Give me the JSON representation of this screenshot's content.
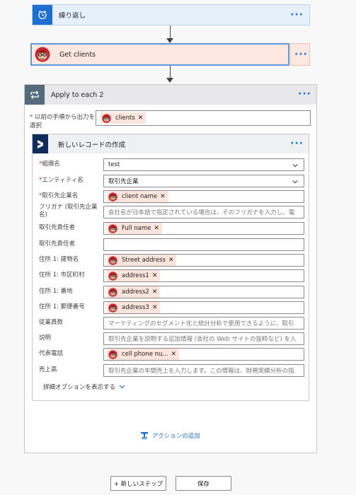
{
  "cards": {
    "repeat": {
      "title": "繰り返し",
      "icon": "alarm-clock-icon"
    },
    "get_clients": {
      "title": "Get clients",
      "icon": "avatar-icon"
    }
  },
  "more_label": "···",
  "apply": {
    "title": "Apply to each 2",
    "icon": "loop-icon",
    "prev_label": "以前の手順から出力を選択",
    "prev_chip": "clients"
  },
  "inner": {
    "title": "新しいレコードの作成",
    "icon": "dynamics-icon",
    "fields": [
      {
        "label": "組織名",
        "required": true,
        "value": "test",
        "type": "dropdown"
      },
      {
        "label": "エンティティ名",
        "required": true,
        "value": "取引先企業",
        "type": "dropdown"
      },
      {
        "label": "取引先企業名",
        "required": true,
        "chip": "client name",
        "type": "chip"
      },
      {
        "label": "フリガナ (取引先企業名)",
        "required": false,
        "placeholder": "会社名が日本語で指定されている場合は、そのフリガナを入力し、電",
        "type": "placeholder"
      },
      {
        "label": "取引先責任者",
        "required": false,
        "chip": "Full name",
        "type": "chip"
      },
      {
        "label": "取引先責任者",
        "required": false,
        "value": "",
        "type": "empty"
      },
      {
        "label": "住所 1: 建物名",
        "required": false,
        "chip": "Street address",
        "type": "chip"
      },
      {
        "label": "住所 1: 市区町村",
        "required": false,
        "chip": "address1",
        "type": "chip"
      },
      {
        "label": "住所 1: 番地",
        "required": false,
        "chip": "address2",
        "type": "chip"
      },
      {
        "label": "住所 1: 郵便番号",
        "required": false,
        "chip": "address3",
        "type": "chip"
      },
      {
        "label": "従業員数",
        "required": false,
        "placeholder": "マーケティングのセグメント化と統計分析で使用できるように、取引",
        "type": "placeholder"
      },
      {
        "label": "説明",
        "required": false,
        "placeholder": "取引先企業を説明する追加情報 (会社の Web サイトの抜粋など) を入",
        "type": "placeholder"
      },
      {
        "label": "代表電話",
        "required": false,
        "chip": "cell phone nu...",
        "type": "chip"
      },
      {
        "label": "売上高",
        "required": false,
        "placeholder": "取引先企業の年間売上を入力します。この情報は、財務実績分析の指",
        "type": "placeholder"
      }
    ],
    "advanced_options": "詳細オプションを表示する"
  },
  "add_action": "アクションの追加",
  "buttons": {
    "new_step": "+ 新しいステップ",
    "save": "保存"
  },
  "colors": {
    "accent": "#1f6fd1",
    "chip_bg": "#fbe4dc",
    "card_pink": "#fde7e0",
    "card_blue": "#e6f0fb"
  }
}
